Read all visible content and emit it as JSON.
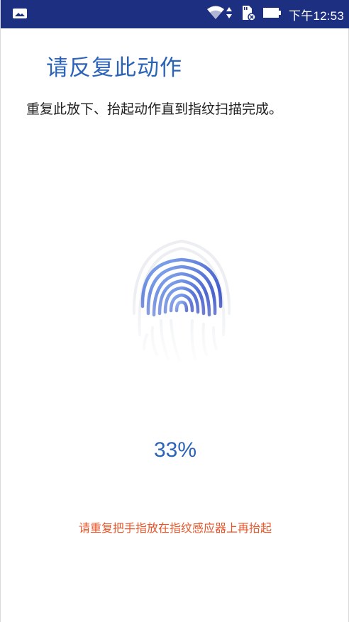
{
  "status_bar": {
    "time": "下午12:53",
    "background_color": "#1c2f80",
    "icons": [
      "image-icon",
      "wifi-icon",
      "data-arrows-icon",
      "sd-card-icon",
      "battery-icon"
    ]
  },
  "title": "请反复此动作",
  "subtitle": "重复此放下、抬起动作直到指纹扫描完成。",
  "fingerprint": {
    "icon": "fingerprint-icon",
    "progress": 0.33
  },
  "progress_text": "33%",
  "hint": "请重复把手指放在指纹感应器上再抬起",
  "colors": {
    "accent": "#2b63b8",
    "hint": "#e8552a",
    "text": "#222222"
  }
}
